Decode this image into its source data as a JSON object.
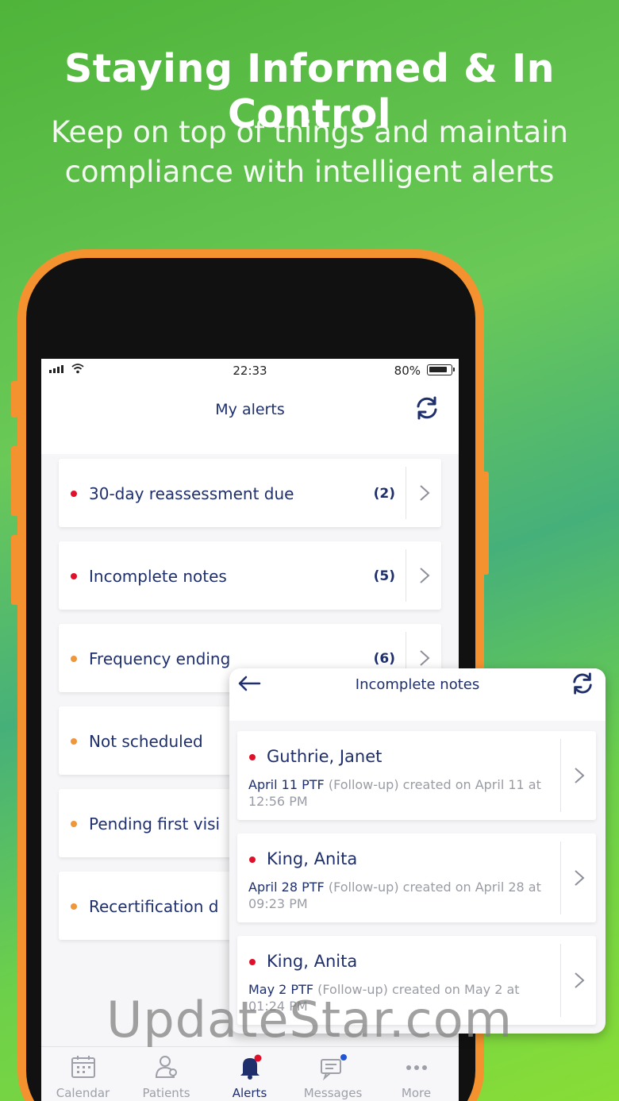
{
  "promo": {
    "headline": "Staying Informed & In Control",
    "subline": "Keep on top of things and maintain compliance with intelligent alerts"
  },
  "status_bar": {
    "time": "22:33",
    "battery": "80%"
  },
  "header": {
    "title": "My alerts",
    "refresh_icon": "refresh-icon"
  },
  "colors": {
    "accent": "#1e2f6c",
    "red": "#e0102a",
    "orange": "#f0963a",
    "frame": "#f4922f"
  },
  "alerts": [
    {
      "label": "30-day reassessment due",
      "count": "(2)",
      "dot": "red"
    },
    {
      "label": "Incomplete notes",
      "count": "(5)",
      "dot": "red"
    },
    {
      "label": "Frequency ending",
      "count": "(6)",
      "dot": "orange"
    },
    {
      "label": "Not scheduled",
      "count": "",
      "dot": "orange"
    },
    {
      "label": "Pending first visi",
      "count": "",
      "dot": "orange"
    },
    {
      "label": "Recertification d",
      "count": "",
      "dot": "orange"
    }
  ],
  "detail": {
    "title": "Incomplete notes",
    "notes": [
      {
        "name": "Guthrie, Janet",
        "date": "April 11 PTF",
        "rest": "(Follow-up) created on April 11 at 12:56 PM"
      },
      {
        "name": "King, Anita",
        "date": "April 28 PTF",
        "rest": "(Follow-up) created on April 28 at 09:23 PM"
      },
      {
        "name": "King, Anita",
        "date": "May 2 PTF",
        "rest": "(Follow-up) created on May 2 at 01:24 PM"
      }
    ]
  },
  "tabs": [
    {
      "label": "Calendar",
      "icon": "calendar-icon"
    },
    {
      "label": "Patients",
      "icon": "patients-icon"
    },
    {
      "label": "Alerts",
      "icon": "bell-icon"
    },
    {
      "label": "Messages",
      "icon": "messages-icon"
    },
    {
      "label": "More",
      "icon": "more-icon"
    }
  ],
  "watermark": "UpdateStar.com"
}
